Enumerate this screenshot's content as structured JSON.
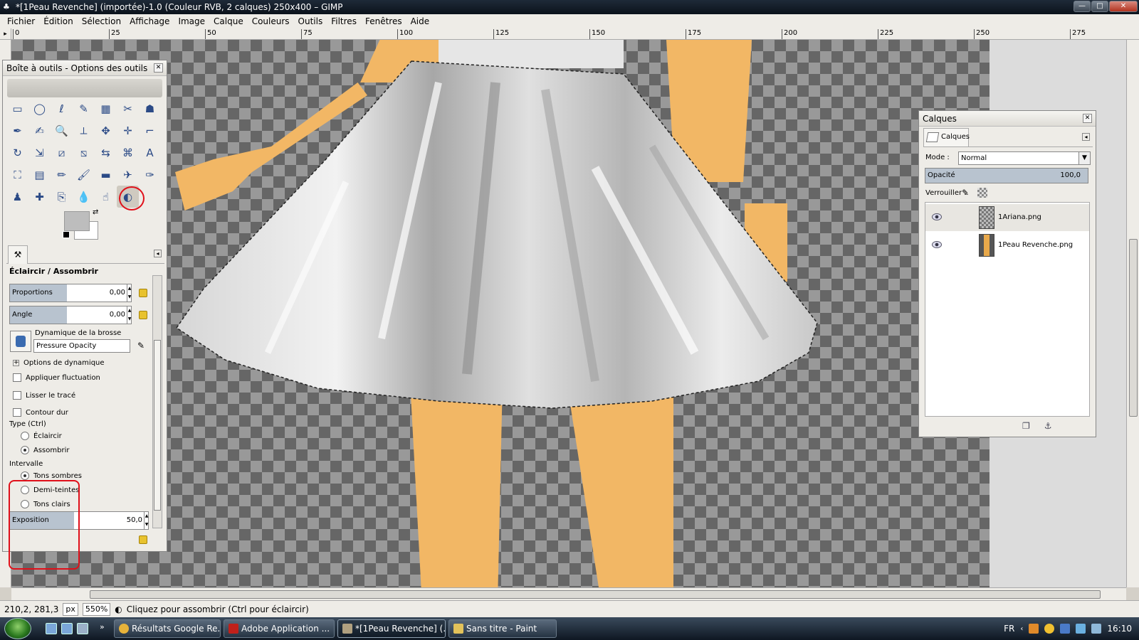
{
  "window": {
    "title": "*[1Peau Revenche] (importée)-1.0 (Couleur RVB, 2 calques) 250x400 – GIMP",
    "app_glyph": "♣",
    "btn_min": "—",
    "btn_max": "□",
    "btn_close": "✕"
  },
  "menu": [
    "Fichier",
    "Édition",
    "Sélection",
    "Affichage",
    "Image",
    "Calque",
    "Couleurs",
    "Outils",
    "Filtres",
    "Fenêtres",
    "Aide"
  ],
  "ruler": {
    "ticks": [
      "0",
      "25",
      "50",
      "75",
      "100",
      "125",
      "150",
      "175",
      "200",
      "225",
      "250",
      "275"
    ]
  },
  "toolbox": {
    "title": "Boîte à outils - Options des outils",
    "active_tool": "dodge-burn",
    "tool_icons": [
      "rect-select-icon",
      "ellipse-select-icon",
      "lasso-icon",
      "fuzzy-select-icon",
      "color-select-icon",
      "scissors-icon",
      "foreground-select-icon",
      "paths-icon",
      "color-picker-icon",
      "zoom-icon",
      "measure-icon",
      "move-icon",
      "align-icon",
      "crop-icon",
      "rotate-icon",
      "scale-icon",
      "shear-icon",
      "perspective-icon",
      "flip-icon",
      "cage-icon",
      "text-icon",
      "bucket-fill-icon",
      "blend-icon",
      "pencil-icon",
      "paintbrush-icon",
      "eraser-icon",
      "airbrush-icon",
      "ink-icon",
      "clone-icon",
      "heal-icon",
      "perspective-clone-icon",
      "blur-icon",
      "smudge-icon",
      "dodge-burn-icon"
    ],
    "tool_glyphs": [
      "▭",
      "◯",
      "ℓ",
      "✎",
      "▦",
      "✂",
      "☗",
      "✒",
      "✍",
      "🔍",
      "⟂",
      "✥",
      "✛",
      "⌐",
      "↻",
      "⇲",
      "⧄",
      "⧅",
      "⇆",
      "⌘",
      "A",
      "⛶",
      "▤",
      "✏",
      "🖌",
      "▬",
      "✈",
      "✑",
      "♟",
      "✚",
      "⎘",
      "💧",
      "☝",
      "◐"
    ],
    "options_title": "Éclaircir / Assombrir",
    "proportions_label": "Proportions",
    "proportions_value": "0,00",
    "angle_label": "Angle",
    "angle_value": "0,00",
    "dynamics_label": "Dynamique de la brosse",
    "dynamics_value": "Pressure Opacity",
    "dynamics_options": "Options de dynamique",
    "apply_jitter": "Appliquer fluctuation",
    "smooth_stroke": "Lisser le tracé",
    "hard_edge": "Contour dur",
    "type_label": "Type (Ctrl)",
    "type_dodge": "Éclaircir",
    "type_burn": "Assombrir",
    "type_selected": "Assombrir",
    "range_label": "Intervalle",
    "range_shadows": "Tons sombres",
    "range_midtones": "Demi-teintes",
    "range_highlights": "Tons clairs",
    "range_selected": "Tons sombres",
    "exposure_label": "Exposition",
    "exposure_value": "50,0"
  },
  "status": {
    "coords": "210,2, 281,3",
    "unit": "px",
    "zoom": "550%",
    "message": "Cliquez pour assombrir (Ctrl pour éclaircir)"
  },
  "layers_panel": {
    "title": "Calques",
    "tab_label": "Calques",
    "mode_label": "Mode :",
    "mode_value": "Normal",
    "opacity_label": "Opacité",
    "opacity_value": "100,0",
    "lock_label": "Verrouiller :",
    "layers": [
      {
        "name": "1Ariana.png",
        "visible": true,
        "selected": true
      },
      {
        "name": "1Peau Revenche.png",
        "visible": true,
        "selected": false
      }
    ]
  },
  "taskbar": {
    "items": [
      {
        "label": "Résultats Google Re...",
        "icon": "chrome-icon",
        "color": "#e8b33a"
      },
      {
        "label": "Adobe Application ...",
        "icon": "adobe-icon",
        "color": "#c0201a"
      },
      {
        "label": "*[1Peau Revenche] (...",
        "icon": "gimp-icon",
        "color": "#b0a080"
      },
      {
        "label": "Sans titre - Paint",
        "icon": "paint-icon",
        "color": "#e3c25a"
      }
    ],
    "language": "FR",
    "clock": "16:10"
  },
  "colors": {
    "skin": "#f2b765",
    "highlight_red": "#e0101a",
    "selection_blue": "#b8c3cf"
  }
}
